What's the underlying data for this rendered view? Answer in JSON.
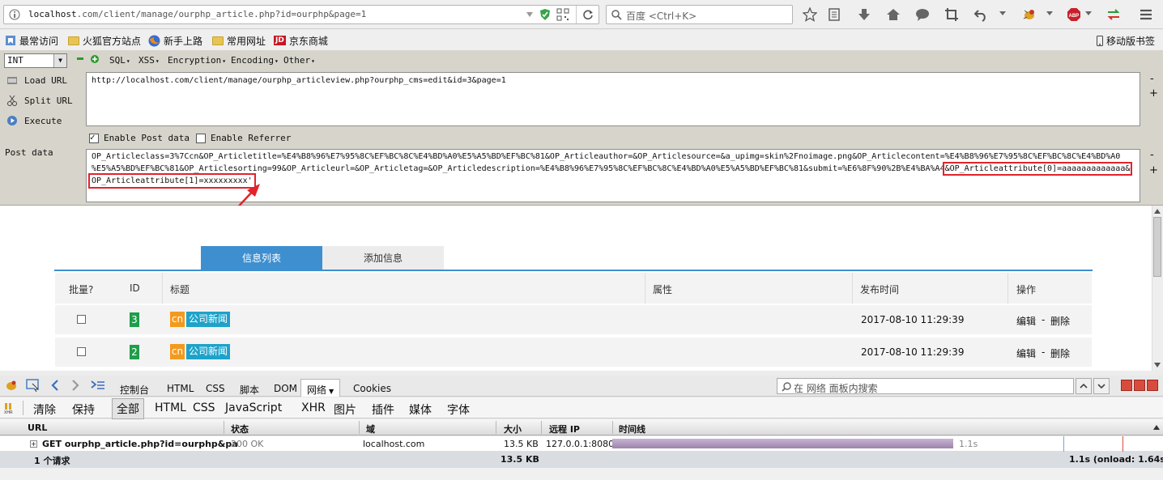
{
  "browser": {
    "url_host": "localhost",
    "url_path": ".com/client/manage/ourphp_article.php?id=ourphp&page=1",
    "search_placeholder": "百度 <Ctrl+K>"
  },
  "bookmarks": {
    "items": [
      "最常访问",
      "火狐官方站点",
      "新手上路",
      "常用网址",
      "京东商城"
    ],
    "jd_badge": "JD",
    "mobile": "移动版书签"
  },
  "hackbar": {
    "type_select": "INT",
    "menus": [
      "SQL",
      "XSS",
      "Encryption",
      "Encoding",
      "Other"
    ],
    "load_url": "Load URL",
    "split_url": "Split URL",
    "execute": "Execute",
    "url_value": "http://localhost.com/client/manage/ourphp_articleview.php?ourphp_cms=edit&id=3&page=1",
    "enable_post": "Enable Post data",
    "enable_referrer": "Enable Referrer",
    "post_label": "Post data",
    "post_line1": "OP_Articleclass=3%7Ccn&OP_Articletitle=%E4%B8%96%E7%95%8C%EF%BC%8C%E4%BD%A0%E5%A5%BD%EF%BC%81&OP_Articleauthor=&OP_Articlesource=&a_upimg=skin%2Fnoimage.png&OP_Articlecontent=%E4%B8%96%E7%95%8C%EF%BC%8C%E4%BD%A0",
    "post_line2a": "%E5%A5%BD%EF%BC%81&OP_Articlesorting=99&OP_Articleurl=&OP_Articletag=&OP_Articledescription=%E4%B8%96%E7%95%8C%EF%BC%8C%E4%BD%A0%E5%A5%BD%EF%BC%81&submit=%E6%8F%90%2B%E4%BA%A4",
    "post_line2b": "&OP_Articleattribute[0]=aaaaaaaaaaaaa&",
    "post_line3": "OP_Articleattribute[1]=xxxxxxxxx'",
    "minus": "-",
    "plus": "+"
  },
  "page": {
    "tabs": [
      "信息列表",
      "添加信息"
    ],
    "columns": [
      "批量?",
      "ID",
      "标题",
      "属性",
      "发布时间",
      "操作"
    ],
    "rows": [
      {
        "id": "3",
        "lang": "cn",
        "category": "公司新闻",
        "time": "2017-08-10 11:29:39",
        "edit": "编辑",
        "sep": "-",
        "del": "删除"
      },
      {
        "id": "2",
        "lang": "cn",
        "category": "公司新闻",
        "time": "2017-08-10 11:29:39",
        "edit": "编辑",
        "sep": "-",
        "del": "删除"
      }
    ]
  },
  "firebug": {
    "tabs": [
      "控制台",
      "HTML",
      "CSS",
      "脚本",
      "DOM",
      "网络",
      "Cookies"
    ],
    "search_placeholder": "在 网络 面板内搜索",
    "subtabs": [
      "清除",
      "保持",
      "全部",
      "HTML",
      "CSS",
      "JavaScript",
      "XHR",
      "图片",
      "插件",
      "媒体",
      "字体"
    ],
    "columns": [
      "URL",
      "状态",
      "域",
      "大小",
      "远程 IP",
      "时间线"
    ],
    "request": {
      "url": "GET ourphp_article.php?id=ourphp&pa",
      "status": "200 OK",
      "domain": "localhost.com",
      "size": "13.5 KB",
      "ip": "127.0.0.1:8080",
      "time": "1.1s",
      "timeline_fraction": 0.65
    },
    "summary": {
      "count": "1 个请求",
      "size": "13.5 KB",
      "time": "1.1s (onload: 1.64s)"
    }
  },
  "colors": {
    "accent": "#3d8fd0",
    "id_badge": "#1f9e4a",
    "lang_badge": "#f39a1e",
    "cat_badge": "#1ea2c9",
    "highlight": "#e0242b"
  }
}
